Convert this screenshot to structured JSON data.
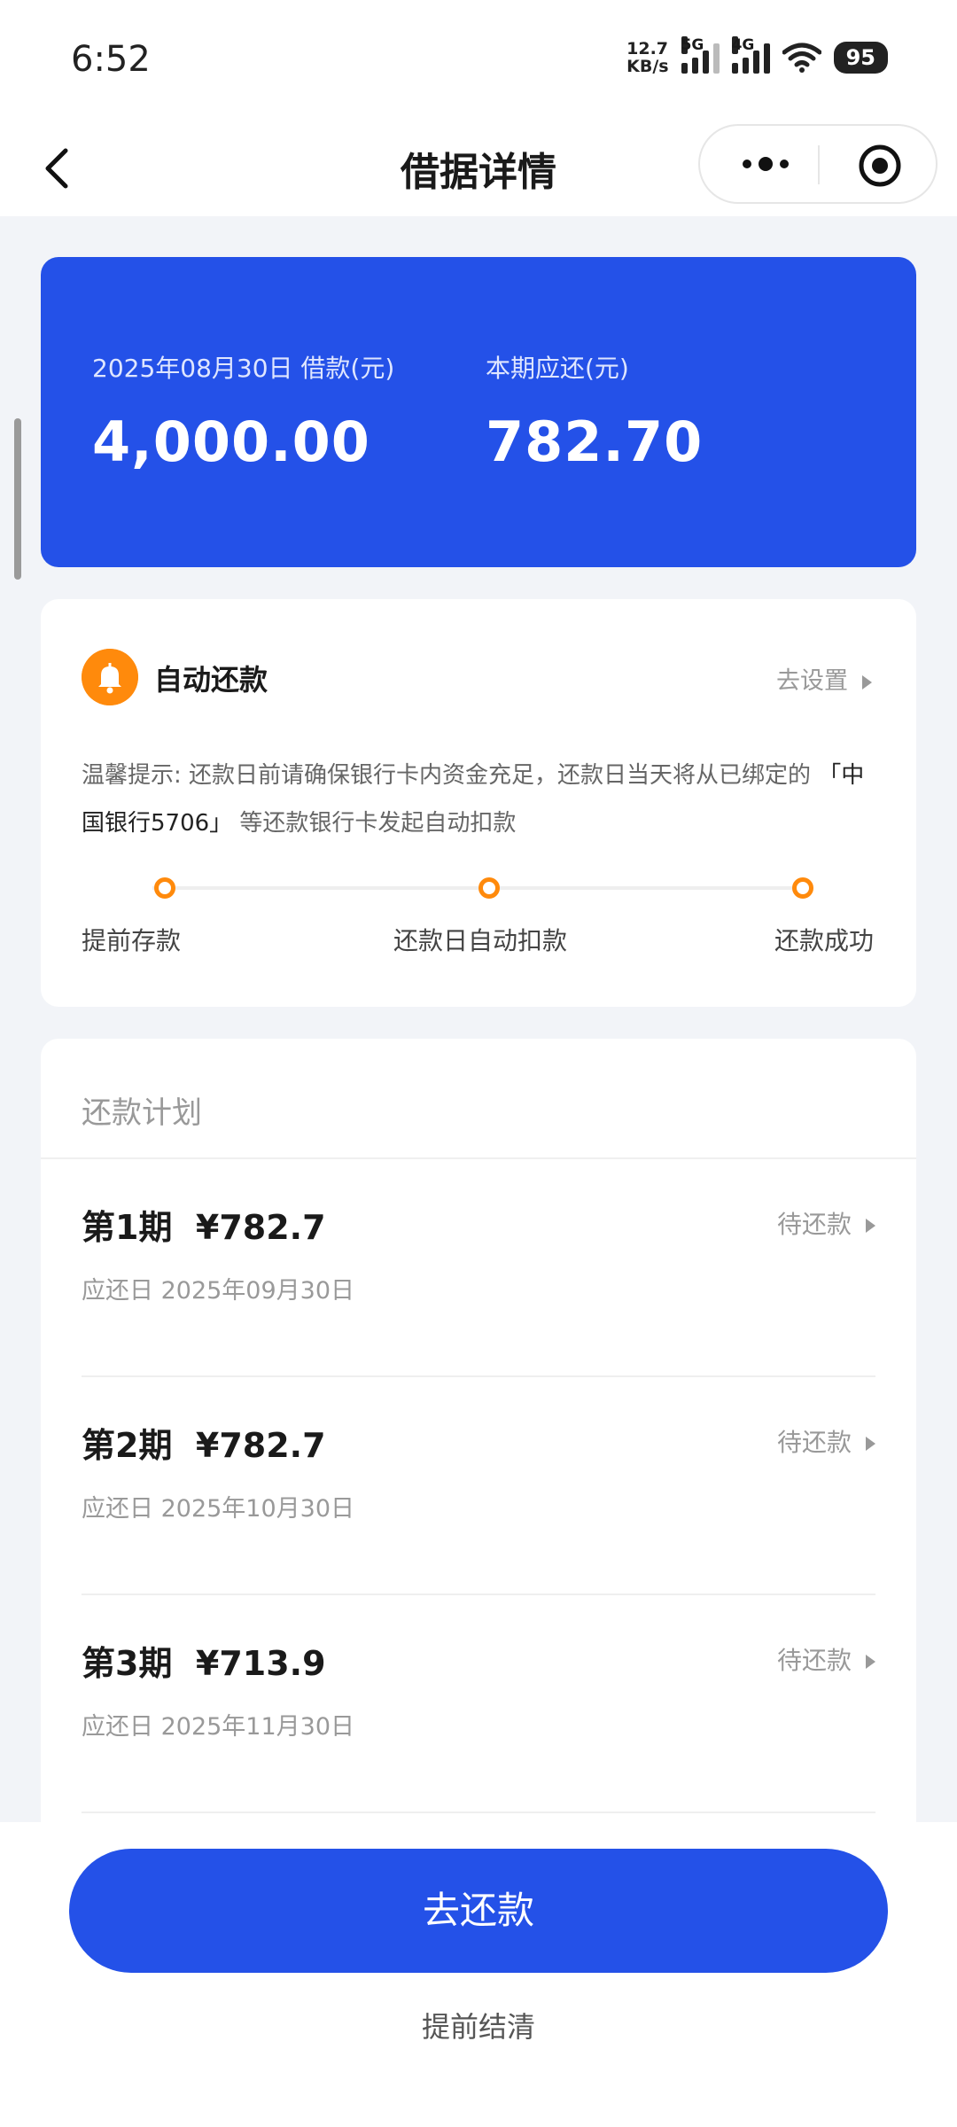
{
  "status_bar": {
    "time": "6:52",
    "net_speed": "12.7",
    "net_unit": "KB/s",
    "sig1": "5G",
    "sig2": "4G",
    "battery": "95"
  },
  "nav": {
    "title": "借据详情"
  },
  "loan": {
    "amount_label": "2025年08月30日 借款(元)",
    "amount": "4,000.00",
    "due_label": "本期应还(元)",
    "due": "782.70"
  },
  "auto_repay": {
    "title": "自动还款",
    "action": "去设置",
    "tip_prefix": "温馨提示: 还款日前请确保银行卡内资金充足，还款日当天将从已绑定的 ",
    "tip_bank": "「中国银行5706」",
    "tip_suffix": " 等还款银行卡发起自动扣款",
    "steps": [
      "提前存款",
      "还款日自动扣款",
      "还款成功"
    ]
  },
  "plan": {
    "title": "还款计划",
    "items": [
      {
        "term": "第1期",
        "amount": "¥782.7",
        "date": "应还日 2025年09月30日",
        "status": "待还款"
      },
      {
        "term": "第2期",
        "amount": "¥782.7",
        "date": "应还日 2025年10月30日",
        "status": "待还款"
      },
      {
        "term": "第3期",
        "amount": "¥713.9",
        "date": "应还日 2025年11月30日",
        "status": "待还款"
      }
    ]
  },
  "actions": {
    "pay": "去还款",
    "early": "提前结清"
  },
  "colors": {
    "primary": "#2451e8",
    "accent": "#ff8a0c"
  }
}
